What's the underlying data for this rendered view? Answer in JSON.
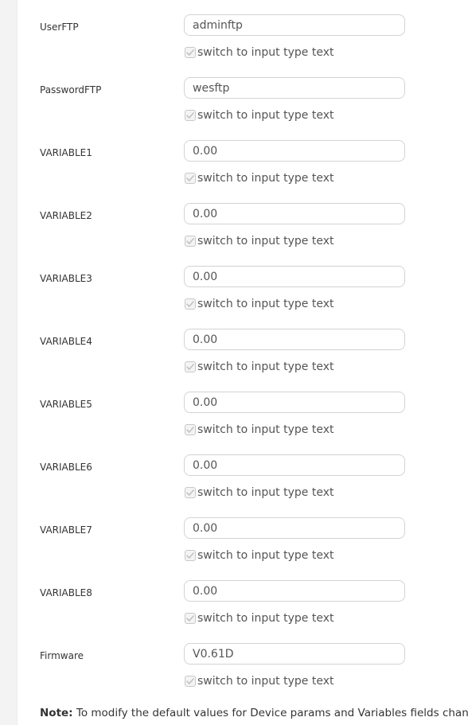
{
  "toggle_label": "switch to input type text",
  "fields": [
    {
      "label": "UserFTP",
      "value": "adminftp"
    },
    {
      "label": "PasswordFTP",
      "value": "wesftp"
    },
    {
      "label": "VARIABLE1",
      "value": "0.00"
    },
    {
      "label": "VARIABLE2",
      "value": "0.00"
    },
    {
      "label": "VARIABLE3",
      "value": "0.00"
    },
    {
      "label": "VARIABLE4",
      "value": "0.00"
    },
    {
      "label": "VARIABLE5",
      "value": "0.00"
    },
    {
      "label": "VARIABLE6",
      "value": "0.00"
    },
    {
      "label": "VARIABLE7",
      "value": "0.00"
    },
    {
      "label": "VARIABLE8",
      "value": "0.00"
    },
    {
      "label": "Firmware",
      "value": "V0.61D"
    }
  ],
  "note": {
    "prefix": "Note:",
    "text": "To modify the default values for Device params and Variables fields change the v"
  }
}
